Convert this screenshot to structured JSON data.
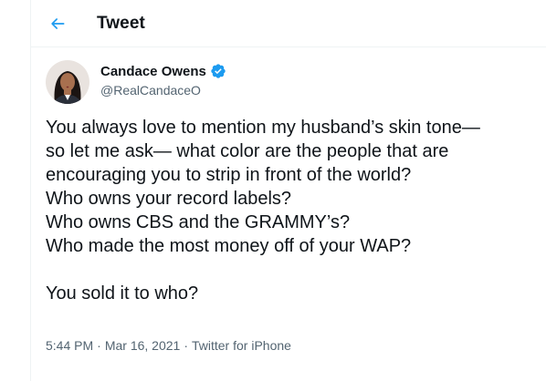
{
  "header": {
    "title": "Tweet",
    "back_icon": "back-arrow-icon",
    "accent_color": "#1d9bf0"
  },
  "author": {
    "display_name": "Candace Owens",
    "handle": "@RealCandaceO",
    "verified_icon": "verified-badge-icon"
  },
  "tweet": {
    "lines": [
      "You always love to mention my husband’s skin tone—",
      "so let me ask— what color are the people that are",
      "encouraging you to strip in front of the world?",
      "Who owns your record labels?",
      "Who owns CBS and the GRAMMY’s?",
      "Who made the most money off of your WAP?",
      "",
      "You sold it to who?"
    ]
  },
  "meta": {
    "time": "5:44 PM",
    "separator_1": "·",
    "date": "Mar 16, 2021",
    "separator_2": "·",
    "source": "Twitter for iPhone"
  }
}
